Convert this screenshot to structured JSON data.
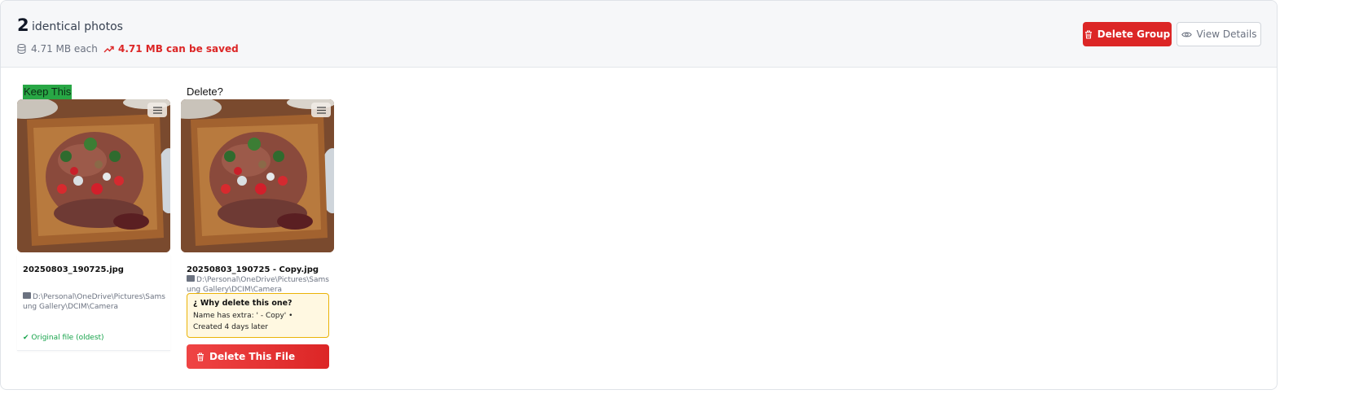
{
  "group": {
    "count": "2",
    "count_label": "identical photos",
    "size_each": "4.71 MB each",
    "savings": "4.71 MB can be saved"
  },
  "actions": {
    "delete_group": "Delete Group",
    "view_details": "View Details"
  },
  "keep": {
    "label": "Keep This",
    "filename": "20250803_190725.jpg",
    "path": "D:\\Personal\\OneDrive\\Pictures\\Samsung Gallery\\DCIM\\Camera",
    "status": "Original file (oldest)"
  },
  "delete": {
    "label": "Delete?",
    "filename": "20250803_190725 - Copy.jpg",
    "path": "D:\\Personal\\OneDrive\\Pictures\\Samsung Gallery\\DCIM\\Camera",
    "why_title": "Why delete this one?",
    "why_text": "Name has extra: ' - Copy' • Created 4 days later",
    "button": "Delete This File"
  },
  "colors": {
    "danger": "#dc2626",
    "keep": "#28a745",
    "warning_border": "#eab308",
    "warning_bg": "#fff8e1"
  },
  "icons": [
    "database-icon",
    "trending-up-icon",
    "trash-icon",
    "eye-icon",
    "menu-icon",
    "folder-icon",
    "check-icon",
    "question-icon"
  ]
}
